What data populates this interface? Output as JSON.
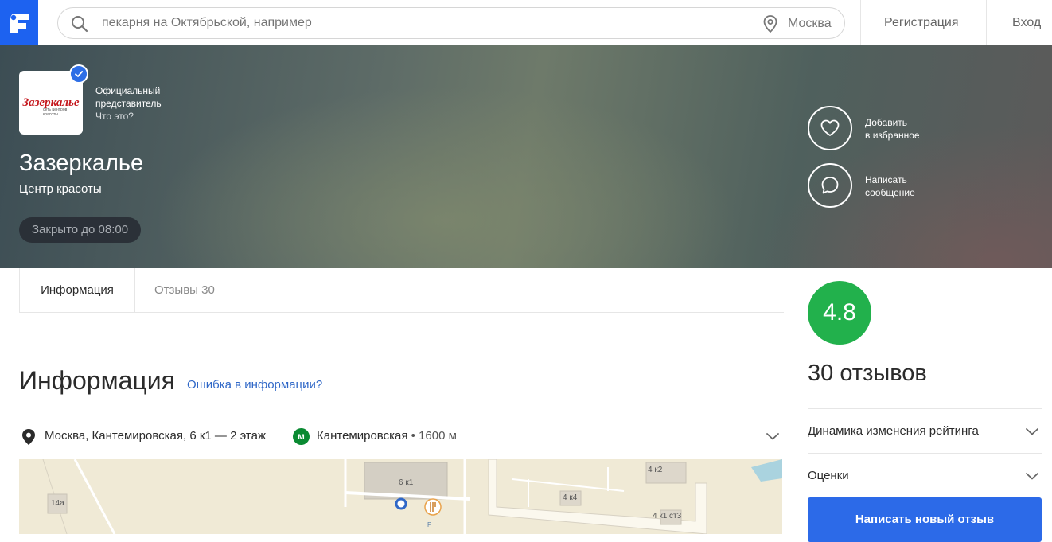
{
  "header": {
    "search_placeholder": "пекарня на Октябрьской, например",
    "city": "Москва",
    "register_label": "Регистрация",
    "login_label": "Вход"
  },
  "business": {
    "logo_text": "Зазеркалье",
    "logo_subtext": "сеть центров красоты",
    "official_line1": "Официальный",
    "official_line2": "представитель",
    "what_is_this": "Что это?",
    "name": "Зазеркалье",
    "category": "Центр красоты",
    "hours_status": "Закрыто до 08:00"
  },
  "actions": {
    "favorite_line1": "Добавить",
    "favorite_line2": "в избранное",
    "message_line1": "Написать",
    "message_line2": "сообщение"
  },
  "tabs": {
    "info": "Информация",
    "reviews": "Отзывы 30"
  },
  "info": {
    "title": "Информация",
    "error_link": "Ошибка в информации?",
    "address": "Москва, Кантемировская, 6 к1 — 2 этаж",
    "metro_letter": "м",
    "metro_station": "Кантемировская",
    "metro_distance": " • 1600 м"
  },
  "map": {
    "labels": [
      "14a",
      "6 к1",
      "4 к4",
      "4 к2",
      "4 к1 ст3",
      "P"
    ]
  },
  "rating": {
    "value": "4.8",
    "reviews_count": "30 отзывов",
    "dynamics_label": "Динамика изменения рейтинга",
    "scores_label": "Оценки",
    "write_review_label": "Написать новый отзыв"
  },
  "colors": {
    "brand_blue": "#1d62f0",
    "rating_green": "#22b14c",
    "link_blue": "#2f67c7",
    "metro_green": "#0a8a32"
  }
}
